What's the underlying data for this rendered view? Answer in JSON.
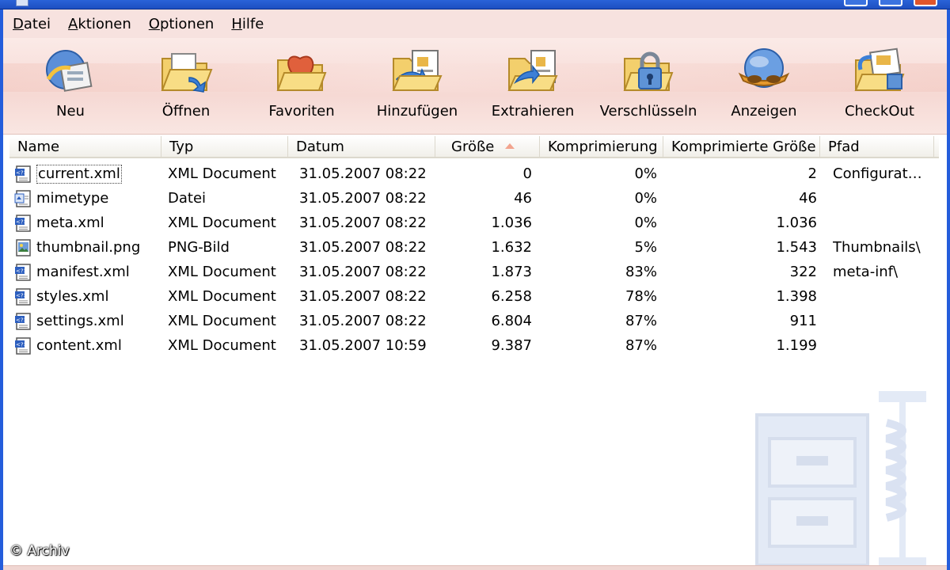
{
  "menu": [
    "Datei",
    "Aktionen",
    "Optionen",
    "Hilfe"
  ],
  "toolbar": [
    {
      "label": "Neu",
      "icon": "new-archive-icon"
    },
    {
      "label": "Öffnen",
      "icon": "open-folder-icon"
    },
    {
      "label": "Favoriten",
      "icon": "favorites-heart-folder-icon"
    },
    {
      "label": "Hinzufügen",
      "icon": "add-files-icon"
    },
    {
      "label": "Extrahieren",
      "icon": "extract-files-icon"
    },
    {
      "label": "Verschlüsseln",
      "icon": "encrypt-lock-icon"
    },
    {
      "label": "Anzeigen",
      "icon": "view-glasses-icon"
    },
    {
      "label": "CheckOut",
      "icon": "checkout-icon"
    }
  ],
  "columns": [
    "Name",
    "Typ",
    "Datum",
    "Größe",
    "Komprimierung",
    "Komprimierte Größe",
    "Pfad"
  ],
  "sort_column": "Größe",
  "files": [
    {
      "name": "current.xml",
      "type": "XML Document",
      "date": "31.05.2007 08:22",
      "size": "0",
      "ratio": "0%",
      "packed": "2",
      "path": "Configurat…",
      "icon": "xml-file-icon"
    },
    {
      "name": "mimetype",
      "type": "Datei",
      "date": "31.05.2007 08:22",
      "size": "46",
      "ratio": "0%",
      "packed": "46",
      "path": "",
      "icon": "generic-file-icon"
    },
    {
      "name": "meta.xml",
      "type": "XML Document",
      "date": "31.05.2007 08:22",
      "size": "1.036",
      "ratio": "0%",
      "packed": "1.036",
      "path": "",
      "icon": "xml-file-icon"
    },
    {
      "name": "thumbnail.png",
      "type": "PNG-Bild",
      "date": "31.05.2007 08:22",
      "size": "1.632",
      "ratio": "5%",
      "packed": "1.543",
      "path": "Thumbnails\\",
      "icon": "image-file-icon"
    },
    {
      "name": "manifest.xml",
      "type": "XML Document",
      "date": "31.05.2007 08:22",
      "size": "1.873",
      "ratio": "83%",
      "packed": "322",
      "path": "meta-inf\\",
      "icon": "xml-file-icon"
    },
    {
      "name": "styles.xml",
      "type": "XML Document",
      "date": "31.05.2007 08:22",
      "size": "6.258",
      "ratio": "78%",
      "packed": "1.398",
      "path": "",
      "icon": "xml-file-icon"
    },
    {
      "name": "settings.xml",
      "type": "XML Document",
      "date": "31.05.2007 08:22",
      "size": "6.804",
      "ratio": "87%",
      "packed": "911",
      "path": "",
      "icon": "xml-file-icon"
    },
    {
      "name": "content.xml",
      "type": "XML Document",
      "date": "31.05.2007 10:59",
      "size": "9.387",
      "ratio": "87%",
      "packed": "1.199",
      "path": "",
      "icon": "xml-file-icon"
    }
  ],
  "focused_row": 0,
  "credit": "© Archiv",
  "colors": {
    "titlebar": "#245ddb",
    "menubar": "#f7e2df",
    "toolbar": "#f6d9d4",
    "sort_arrow": "#f2a48e"
  }
}
